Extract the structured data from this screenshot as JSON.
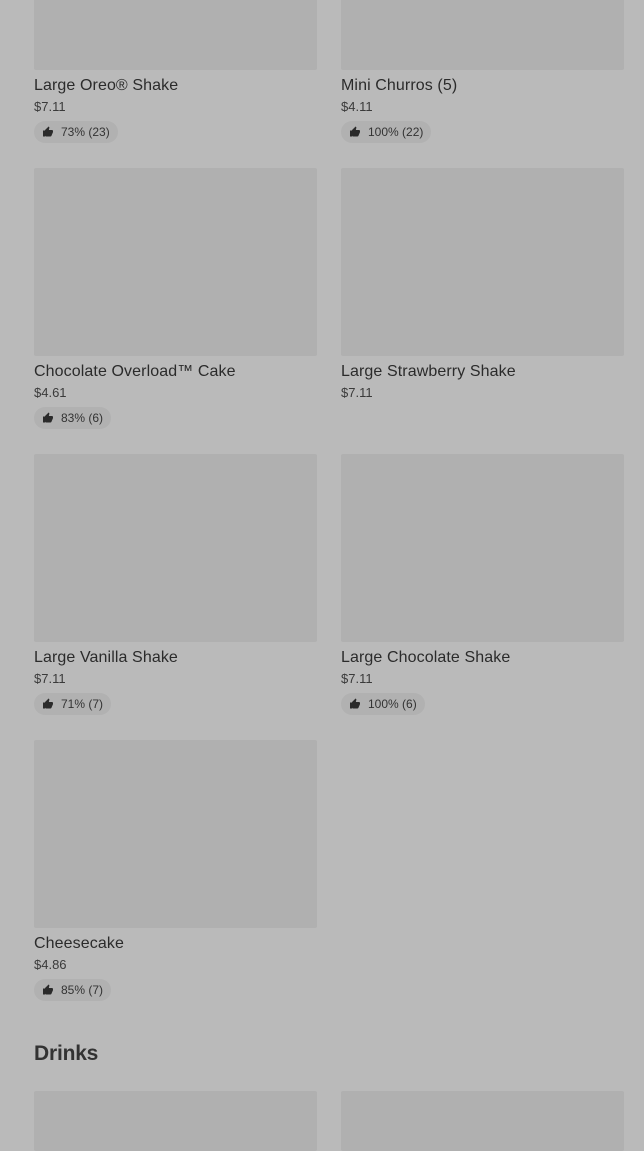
{
  "items": [
    {
      "name": "Large Oreo® Shake",
      "price": "$7.11",
      "rating": "73% (23)"
    },
    {
      "name": "Mini Churros (5)",
      "price": "$4.11",
      "rating": "100% (22)"
    },
    {
      "name": "Chocolate Overload™ Cake",
      "price": "$4.61",
      "rating": "83% (6)"
    },
    {
      "name": "Large Strawberry Shake",
      "price": "$7.11",
      "rating": ""
    },
    {
      "name": "Large Vanilla Shake",
      "price": "$7.11",
      "rating": "71% (7)"
    },
    {
      "name": "Large Chocolate Shake",
      "price": "$7.11",
      "rating": "100% (6)"
    },
    {
      "name": "Cheesecake",
      "price": "$4.86",
      "rating": "85% (7)"
    }
  ],
  "sections": {
    "drinks_title": "Drinks"
  },
  "icons": {
    "rating": "thumbs-up-icon"
  },
  "colors": {
    "background": "#bababa",
    "image_placeholder": "#b0b0b0",
    "text": "#2b2b2b"
  }
}
